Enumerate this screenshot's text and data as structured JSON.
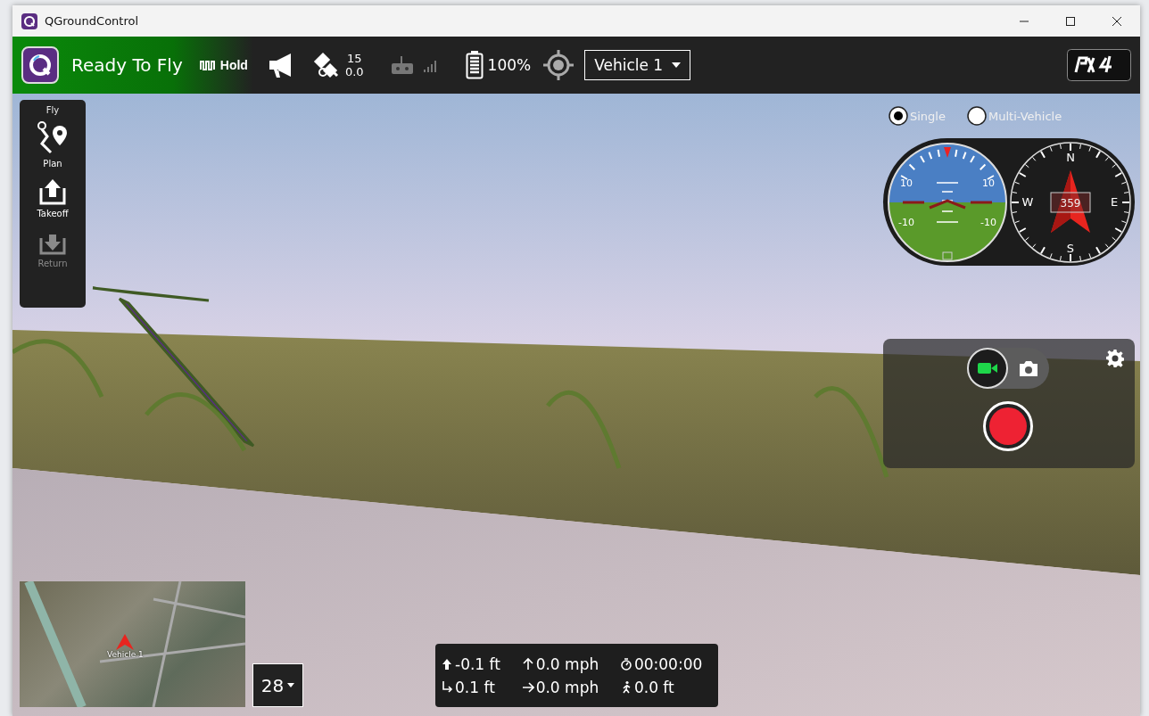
{
  "window": {
    "title": "QGroundControl"
  },
  "toolbar": {
    "status": "Ready To Fly",
    "flight_mode": "Hold",
    "satellites": {
      "count": "15",
      "hdop": "0.0"
    },
    "battery": "100%",
    "vehicle_selector": "Vehicle 1"
  },
  "toolstrip": {
    "title": "Fly",
    "items": [
      {
        "kind": "plan",
        "label": "Plan",
        "disabled": false
      },
      {
        "kind": "takeoff",
        "label": "Takeoff",
        "disabled": false
      },
      {
        "kind": "return",
        "label": "Return",
        "disabled": true
      }
    ]
  },
  "vehicle_view": [
    {
      "label": "Single",
      "selected": true
    },
    {
      "label": "Multi-Vehicle",
      "selected": false
    }
  ],
  "attitude": {
    "pitch_labels": [
      "10",
      "10",
      "-10",
      "-10"
    ]
  },
  "compass": {
    "cardinals": [
      "N",
      "E",
      "S",
      "W"
    ],
    "heading": "359"
  },
  "camera": {
    "modes": [
      {
        "kind": "video",
        "selected": true
      },
      {
        "kind": "photo",
        "selected": false
      }
    ],
    "recording": false
  },
  "map": {
    "vehicle_label": "Vehicle 1"
  },
  "zoom_selector": "28",
  "telemetry": [
    {
      "kind": "altitude",
      "value": "-0.1 ft"
    },
    {
      "kind": "climb",
      "value": "0.0 mph"
    },
    {
      "kind": "time",
      "value": "00:00:00"
    },
    {
      "kind": "distance",
      "value": "0.1 ft"
    },
    {
      "kind": "ground-speed",
      "value": "0.0 mph"
    },
    {
      "kind": "travelled",
      "value": "0.0 ft"
    }
  ]
}
